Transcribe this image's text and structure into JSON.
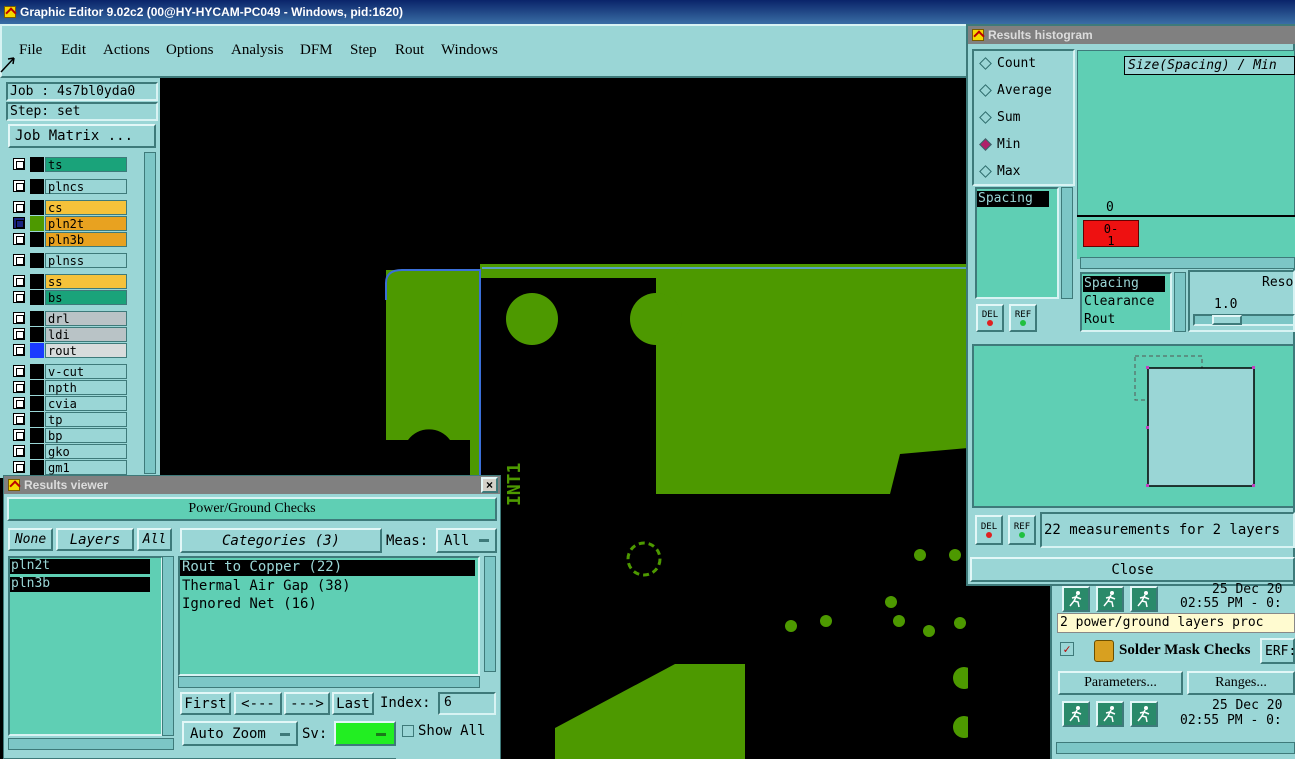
{
  "app": {
    "title": "Graphic Editor 9.02c2 (00@HY-HYCAM-PC049 - Windows, pid:1620)"
  },
  "menu": [
    "File",
    "Edit",
    "Actions",
    "Options",
    "Analysis",
    "DFM",
    "Step",
    "Rout",
    "Windows"
  ],
  "job": {
    "job_label": "Job : 4s7bl0yda0",
    "step_label": "Step: set",
    "matrix_button": "Job Matrix ..."
  },
  "layers": [
    {
      "name": "ts",
      "color": "#1aa37a"
    },
    {
      "name": "plncs",
      "color": "#9ad6d6"
    },
    {
      "name": "cs",
      "color": "#f5c23a"
    },
    {
      "name": "pln2t",
      "color": "#e8a220"
    },
    {
      "name": "pln3b",
      "color": "#e8a220"
    },
    {
      "name": "plnss",
      "color": "#9ad6d6"
    },
    {
      "name": "ss",
      "color": "#f5c23a"
    },
    {
      "name": "bs",
      "color": "#1aa37a"
    },
    {
      "name": "drl",
      "color": "#b9c3c6"
    },
    {
      "name": "ldi",
      "color": "#b9c3c6"
    },
    {
      "name": "rout",
      "color": "#d8dcdc"
    },
    {
      "name": "v-cut",
      "color": "#9ad6d6"
    },
    {
      "name": "npth",
      "color": "#9ad6d6"
    },
    {
      "name": "cvia",
      "color": "#9ad6d6"
    },
    {
      "name": "tp",
      "color": "#9ad6d6"
    },
    {
      "name": "bp",
      "color": "#9ad6d6"
    },
    {
      "name": "gko",
      "color": "#9ad6d6"
    },
    {
      "name": "gm1",
      "color": "#9ad6d6"
    }
  ],
  "canvas": {
    "board_label": "INT1",
    "copper_color": "#4d9900",
    "outline_color": "#3b6fd8"
  },
  "results_viewer": {
    "title": "Results viewer",
    "header": "Power/Ground Checks",
    "none_btn": "None",
    "layers_btn": "Layers",
    "all_btn": "All",
    "categories_btn": "Categories (3)",
    "meas_label": "Meas:",
    "meas_value": "All",
    "layers": [
      "pln2t",
      "pln3b"
    ],
    "categories": [
      "Rout to Copper (22)",
      "Thermal Air Gap (38)",
      "Ignored Net (16)"
    ],
    "first_btn": "First",
    "prev_btn": "<---",
    "next_btn": "--->",
    "last_btn": "Last",
    "index_label": "Index:",
    "index_value": "6",
    "autozoom_btn": "Auto Zoom",
    "sv_label": "Sv:",
    "show_all_label": "Show All"
  },
  "histogram": {
    "title": "Results histogram",
    "modes": [
      "Count",
      "Average",
      "Sum",
      "Min",
      "Max"
    ],
    "selected_mode": "Min",
    "chart_title": "Size(Spacing) / Min",
    "axis_zero": "0",
    "bin_label": "0-1",
    "type_list": [
      "Spacing"
    ],
    "meas_list": [
      "Spacing",
      "Clearance",
      "Rout"
    ],
    "resolution_label": "Reso",
    "resolution_value": "1.0",
    "del_label": "DEL",
    "ref_label": "REF",
    "status": "22 measurements for 2 layers",
    "close_btn": "Close"
  },
  "erf_panel": {
    "date1": "25 Dec 20",
    "time1": "02:55 PM - 0:",
    "message": "2 power/ground layers proc",
    "check_name": "Solder Mask Checks",
    "erf_btn": "ERF:",
    "params_btn": "Parameters...",
    "ranges_btn": "Ranges...",
    "date2": "25 Dec 20",
    "time2": "02:55 PM - 0:"
  }
}
